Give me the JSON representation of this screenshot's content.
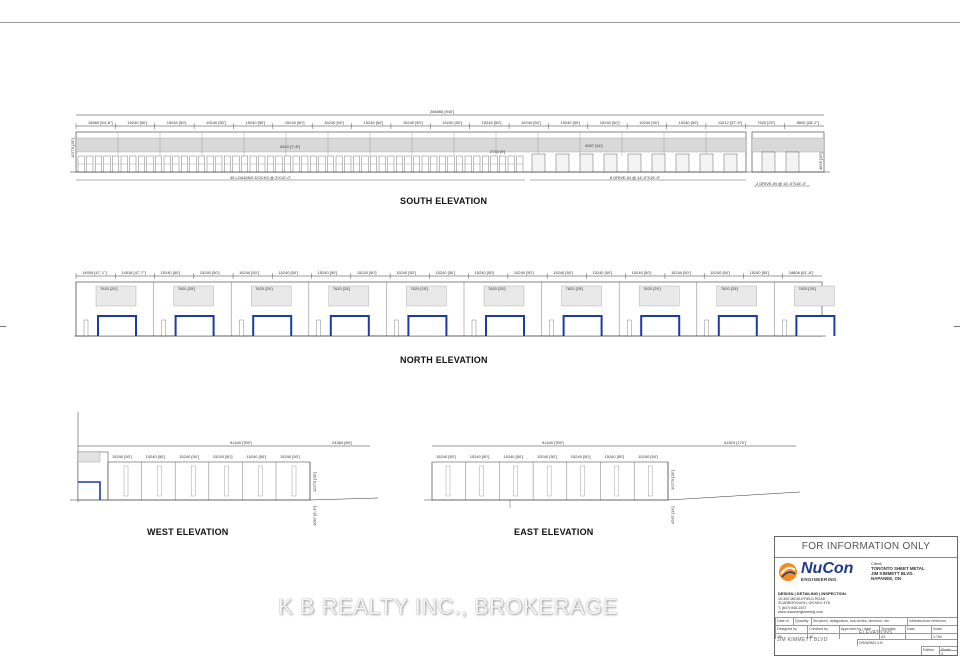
{
  "drawing": {
    "elevations": {
      "south": "SOUTH ELEVATION",
      "north": "NORTH ELEVATION",
      "west": "WEST ELEVATION",
      "east": "EAST ELEVATION"
    },
    "south_dims": {
      "overall": "286566 [940']",
      "first_bay": "16669 [54'-8\"]",
      "bay": "15240 [50']",
      "last_bays": [
        "11012 [37'-5\"]",
        "7620 [25']",
        "8600 [28'-2\"]"
      ],
      "loading_docks": "45 LOADING DOCKS @ 3'X10'-0\"",
      "drive_in": "6 DRIVE-IN @ 14'-0\"X16'-0\"",
      "drive_in_2": "2 DRIVE-IN @ 14'-0\"X16'-0\"",
      "door_width": "2610 [7'-8\"]",
      "door_small": "2743 [9']",
      "height": "10770 [35']",
      "door_height": "4267 [14']",
      "clear": "4878 [16']"
    },
    "north_dims": {
      "bays": [
        "14935 [47'-1\"]",
        "14518 [47'-7\"]",
        "15240 [50']",
        "15240 [50']",
        "15240 [50']",
        "15240 [50']",
        "15240 [50']",
        "15240 [50']",
        "15240 [50']",
        "15240 [50']",
        "15240 [50']",
        "15240 [50']",
        "15240 [50']",
        "15240 [50']",
        "15240 [50']",
        "15240 [50']",
        "15240 [50']",
        "15240 [50']",
        "18806 [61'-8\"]"
      ],
      "openings": "7620 [25']"
    },
    "west_dims": {
      "overall": "91440 [300']",
      "side": "24384 [80']",
      "bay": "15240 [50']",
      "height": "10770 [35']",
      "grade": "1067 [3'-6\"]"
    },
    "east_dims": {
      "overall": "91440 [300']",
      "side": "51823 [170']",
      "bay": "15240 [50']",
      "height": "10770 [35']",
      "grade": "4267 [14']"
    }
  },
  "title_block": {
    "banner": "FOR INFORMATION ONLY",
    "logo": "NuCon",
    "logo_sub": "ENGINEERING",
    "services": "DESIGN | DETAILING | INSPECTION",
    "address": [
      "10-300 MIDDLEFIELD ROAD",
      "SCARBOROUGH, ON M1V 4Y6",
      "T: (647) 846-1927",
      "www.nuconengineering.com"
    ],
    "client_label": "Client:",
    "client_lines": [
      "TORONTO SHEET METAL",
      "JIM KIMMETT BLVD.",
      "NAPANEE, ON"
    ],
    "grid_cells": [
      "Date of",
      "Quantity",
      "Structure, designation, sub-series, direction, etc.",
      "Infrastructure reference",
      "Designed by",
      "Checked by",
      "Approved by / date",
      "Template",
      "Date",
      "Scale",
      "VB",
      "JK",
      "",
      "A3",
      "",
      "1:750"
    ],
    "project": "JIM KIMMETT BLVD",
    "sheet_title": "ELEVATIONS",
    "drawing_no_label": "DRAWING # B",
    "revision_label": "Edition",
    "sheet_label": "Sheet",
    "sheet_no": "3"
  },
  "watermark": "K B REALTY INC., BROKERAGE"
}
